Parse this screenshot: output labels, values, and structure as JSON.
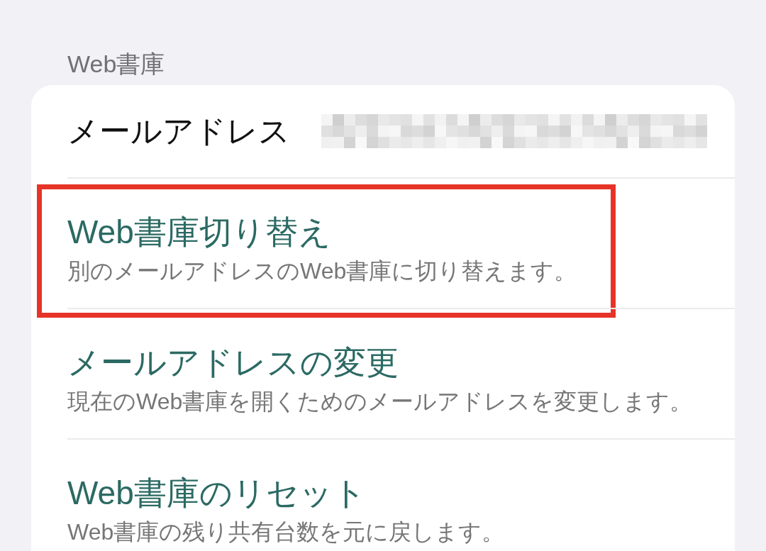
{
  "section_header": "Web書庫",
  "account_row": {
    "label": "メールアドレス",
    "value_redacted": true
  },
  "items": [
    {
      "title": "Web書庫切り替え",
      "description": "別のメールアドレスのWeb書庫に切り替えます。",
      "highlighted": true
    },
    {
      "title": "メールアドレスの変更",
      "description": "現在のWeb書庫を開くためのメールアドレスを変更します。",
      "highlighted": false
    },
    {
      "title": "Web書庫のリセット",
      "description": "Web書庫の残り共有台数を元に戻します。",
      "highlighted": false
    }
  ]
}
